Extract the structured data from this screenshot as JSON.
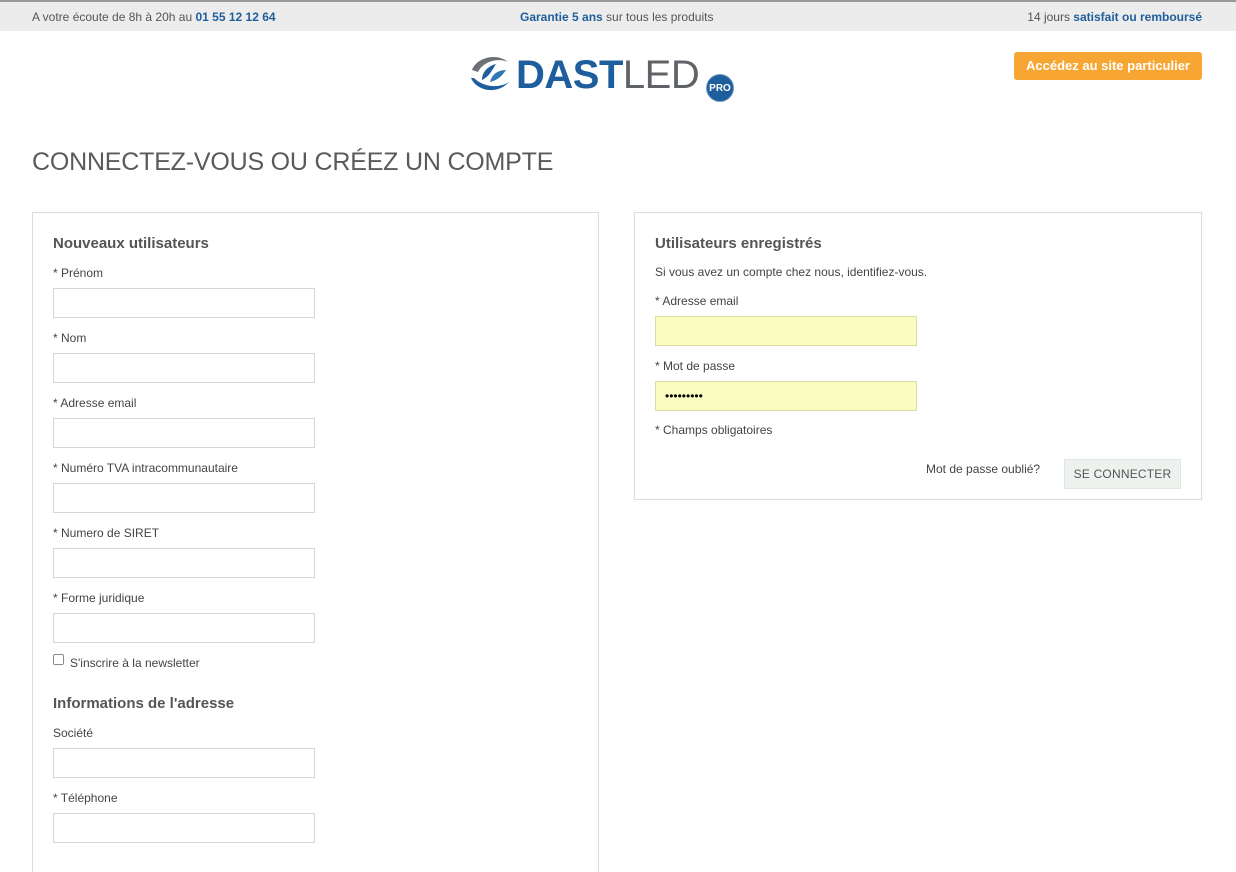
{
  "topbar": {
    "left_text": "A votre écoute de 8h à 20h au ",
    "phone": "01 55 12 12 64",
    "center_bold": "Garantie 5 ans",
    "center_text": " sur tous les produits",
    "right_text": "14 jours ",
    "right_bold": "satisfait ou remboursé"
  },
  "logo": {
    "part1": "DAST",
    "part2": "LED",
    "badge": "PRO",
    "icon": "leaf-swirl-logo-icon"
  },
  "header": {
    "site_button": "Accédez au site particulier"
  },
  "page_title": "CONNECTEZ-VOUS OU CRÉEZ UN COMPTE",
  "new_users": {
    "title": "Nouveaux utilisateurs",
    "fields": [
      {
        "label": "* Prénom",
        "value": ""
      },
      {
        "label": "* Nom",
        "value": ""
      },
      {
        "label": "* Adresse email",
        "value": ""
      },
      {
        "label": "* Numéro TVA intracommunautaire",
        "value": ""
      },
      {
        "label": "* Numero de SIRET",
        "value": ""
      },
      {
        "label": "* Forme juridique",
        "value": ""
      }
    ],
    "newsletter_label": "S'inscrire à la newsletter",
    "address_title": "Informations de l'adresse",
    "address_fields": [
      {
        "label": "Société",
        "value": ""
      },
      {
        "label": "* Téléphone",
        "value": ""
      }
    ]
  },
  "registered": {
    "title": "Utilisateurs enregistrés",
    "intro": "Si vous avez un compte chez nous, identifiez-vous.",
    "email_label": "* Adresse email",
    "email_value": "",
    "password_label": "* Mot de passe",
    "password_value": "•••••••••",
    "required_note": "* Champs obligatoires",
    "forgot_link": "Mot de passe oublié?",
    "login_button": "SE CONNECTER"
  },
  "colors": {
    "brand_blue": "#1f5e9c",
    "accent_orange": "#f7a533",
    "autofill_yellow": "#fafdc2"
  }
}
